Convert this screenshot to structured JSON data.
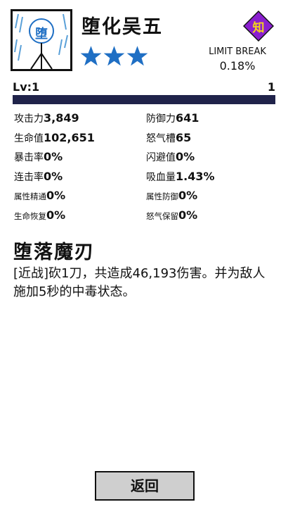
{
  "hero": {
    "portrait_char": "堕",
    "name": "堕化吴五",
    "stars": 3,
    "star_color": "#1f6fc4",
    "class_badge": "知",
    "class_badge_color": "#8a1fcf"
  },
  "limit_break": {
    "label": "LIMIT BREAK",
    "value": "0.18%"
  },
  "level": {
    "label": "Lv:1",
    "value": "1",
    "progress": 0
  },
  "stats": [
    {
      "left": {
        "label": "攻击力",
        "value": "3,849"
      },
      "right": {
        "label": "防御力",
        "value": "641"
      }
    },
    {
      "left": {
        "label": "生命值",
        "value": "102,651"
      },
      "right": {
        "label": "怒气槽",
        "value": "65"
      }
    },
    {
      "left": {
        "label": "暴击率",
        "value": "0%"
      },
      "right": {
        "label": "闪避值",
        "value": "0%"
      }
    },
    {
      "left": {
        "label": "连击率",
        "value": "0%"
      },
      "right": {
        "label": "吸血量",
        "value": "1.43%"
      }
    },
    {
      "left": {
        "label": "属性精通",
        "value": "0%"
      },
      "right": {
        "label": "属性防御",
        "value": "0%"
      }
    },
    {
      "left": {
        "label": "生命恢复",
        "value": "0%"
      },
      "right": {
        "label": "怒气保留",
        "value": "0%"
      }
    }
  ],
  "skill": {
    "name": "堕落魔刃",
    "description": "[近战]砍1刀，共造成46,193伤害。并为敌人施加5秒的中毒状态。"
  },
  "back_button": {
    "label": "返回"
  }
}
